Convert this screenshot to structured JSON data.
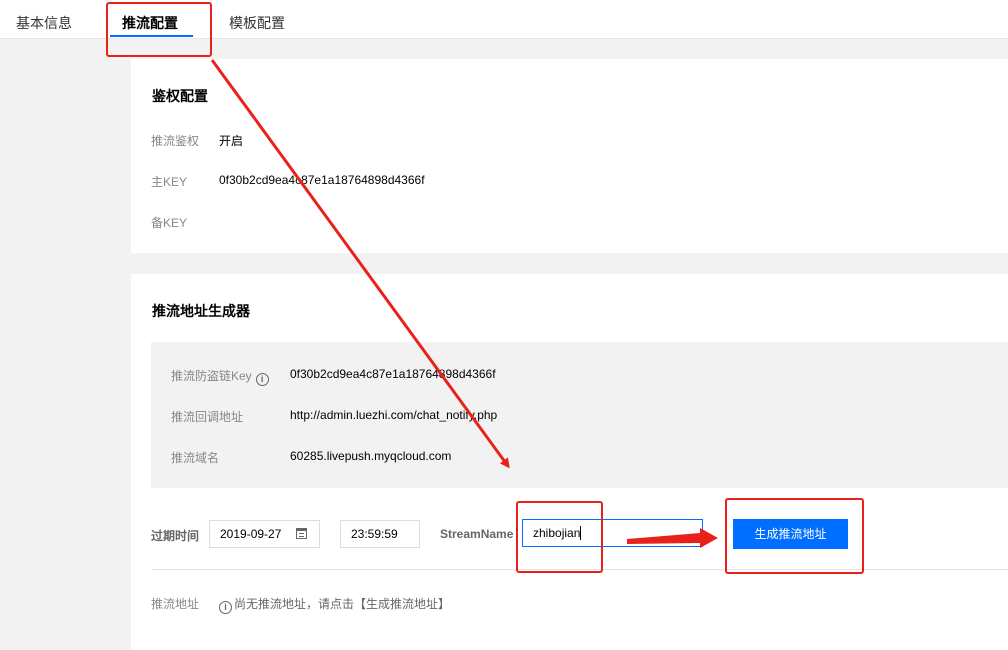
{
  "tabs": [
    {
      "label": "基本信息"
    },
    {
      "label": "推流配置"
    },
    {
      "label": "模板配置"
    }
  ],
  "auth": {
    "title": "鉴权配置",
    "rows": [
      {
        "label": "推流鉴权",
        "value": "开启"
      },
      {
        "label": "主KEY",
        "value": "0f30b2cd9ea4c87e1a18764898d4366f"
      },
      {
        "label": "备KEY",
        "value": ""
      }
    ]
  },
  "generator": {
    "title": "推流地址生成器",
    "info": [
      {
        "label": "推流防盗链Key",
        "value": "0f30b2cd9ea4c87e1a18764898d4366f"
      },
      {
        "label": "推流回调地址",
        "value": "http://admin.luezhi.com/chat_notify.php"
      },
      {
        "label": "推流域名",
        "value": "60285.livepush.myqcloud.com"
      }
    ],
    "expire_label": "过期时间",
    "date_value": "2019-09-27",
    "time_value": "23:59:59",
    "stream_label": "StreamName",
    "stream_value": "zhibojian",
    "button_label": "生成推流地址",
    "address_label": "推流地址",
    "address_hint": "尚无推流地址，请点击【生成推流地址】"
  },
  "icons": {
    "info": "info-circle-icon",
    "calendar": "calendar-icon"
  },
  "colors": {
    "primary": "#006eff",
    "annotation": "#e8221b"
  }
}
